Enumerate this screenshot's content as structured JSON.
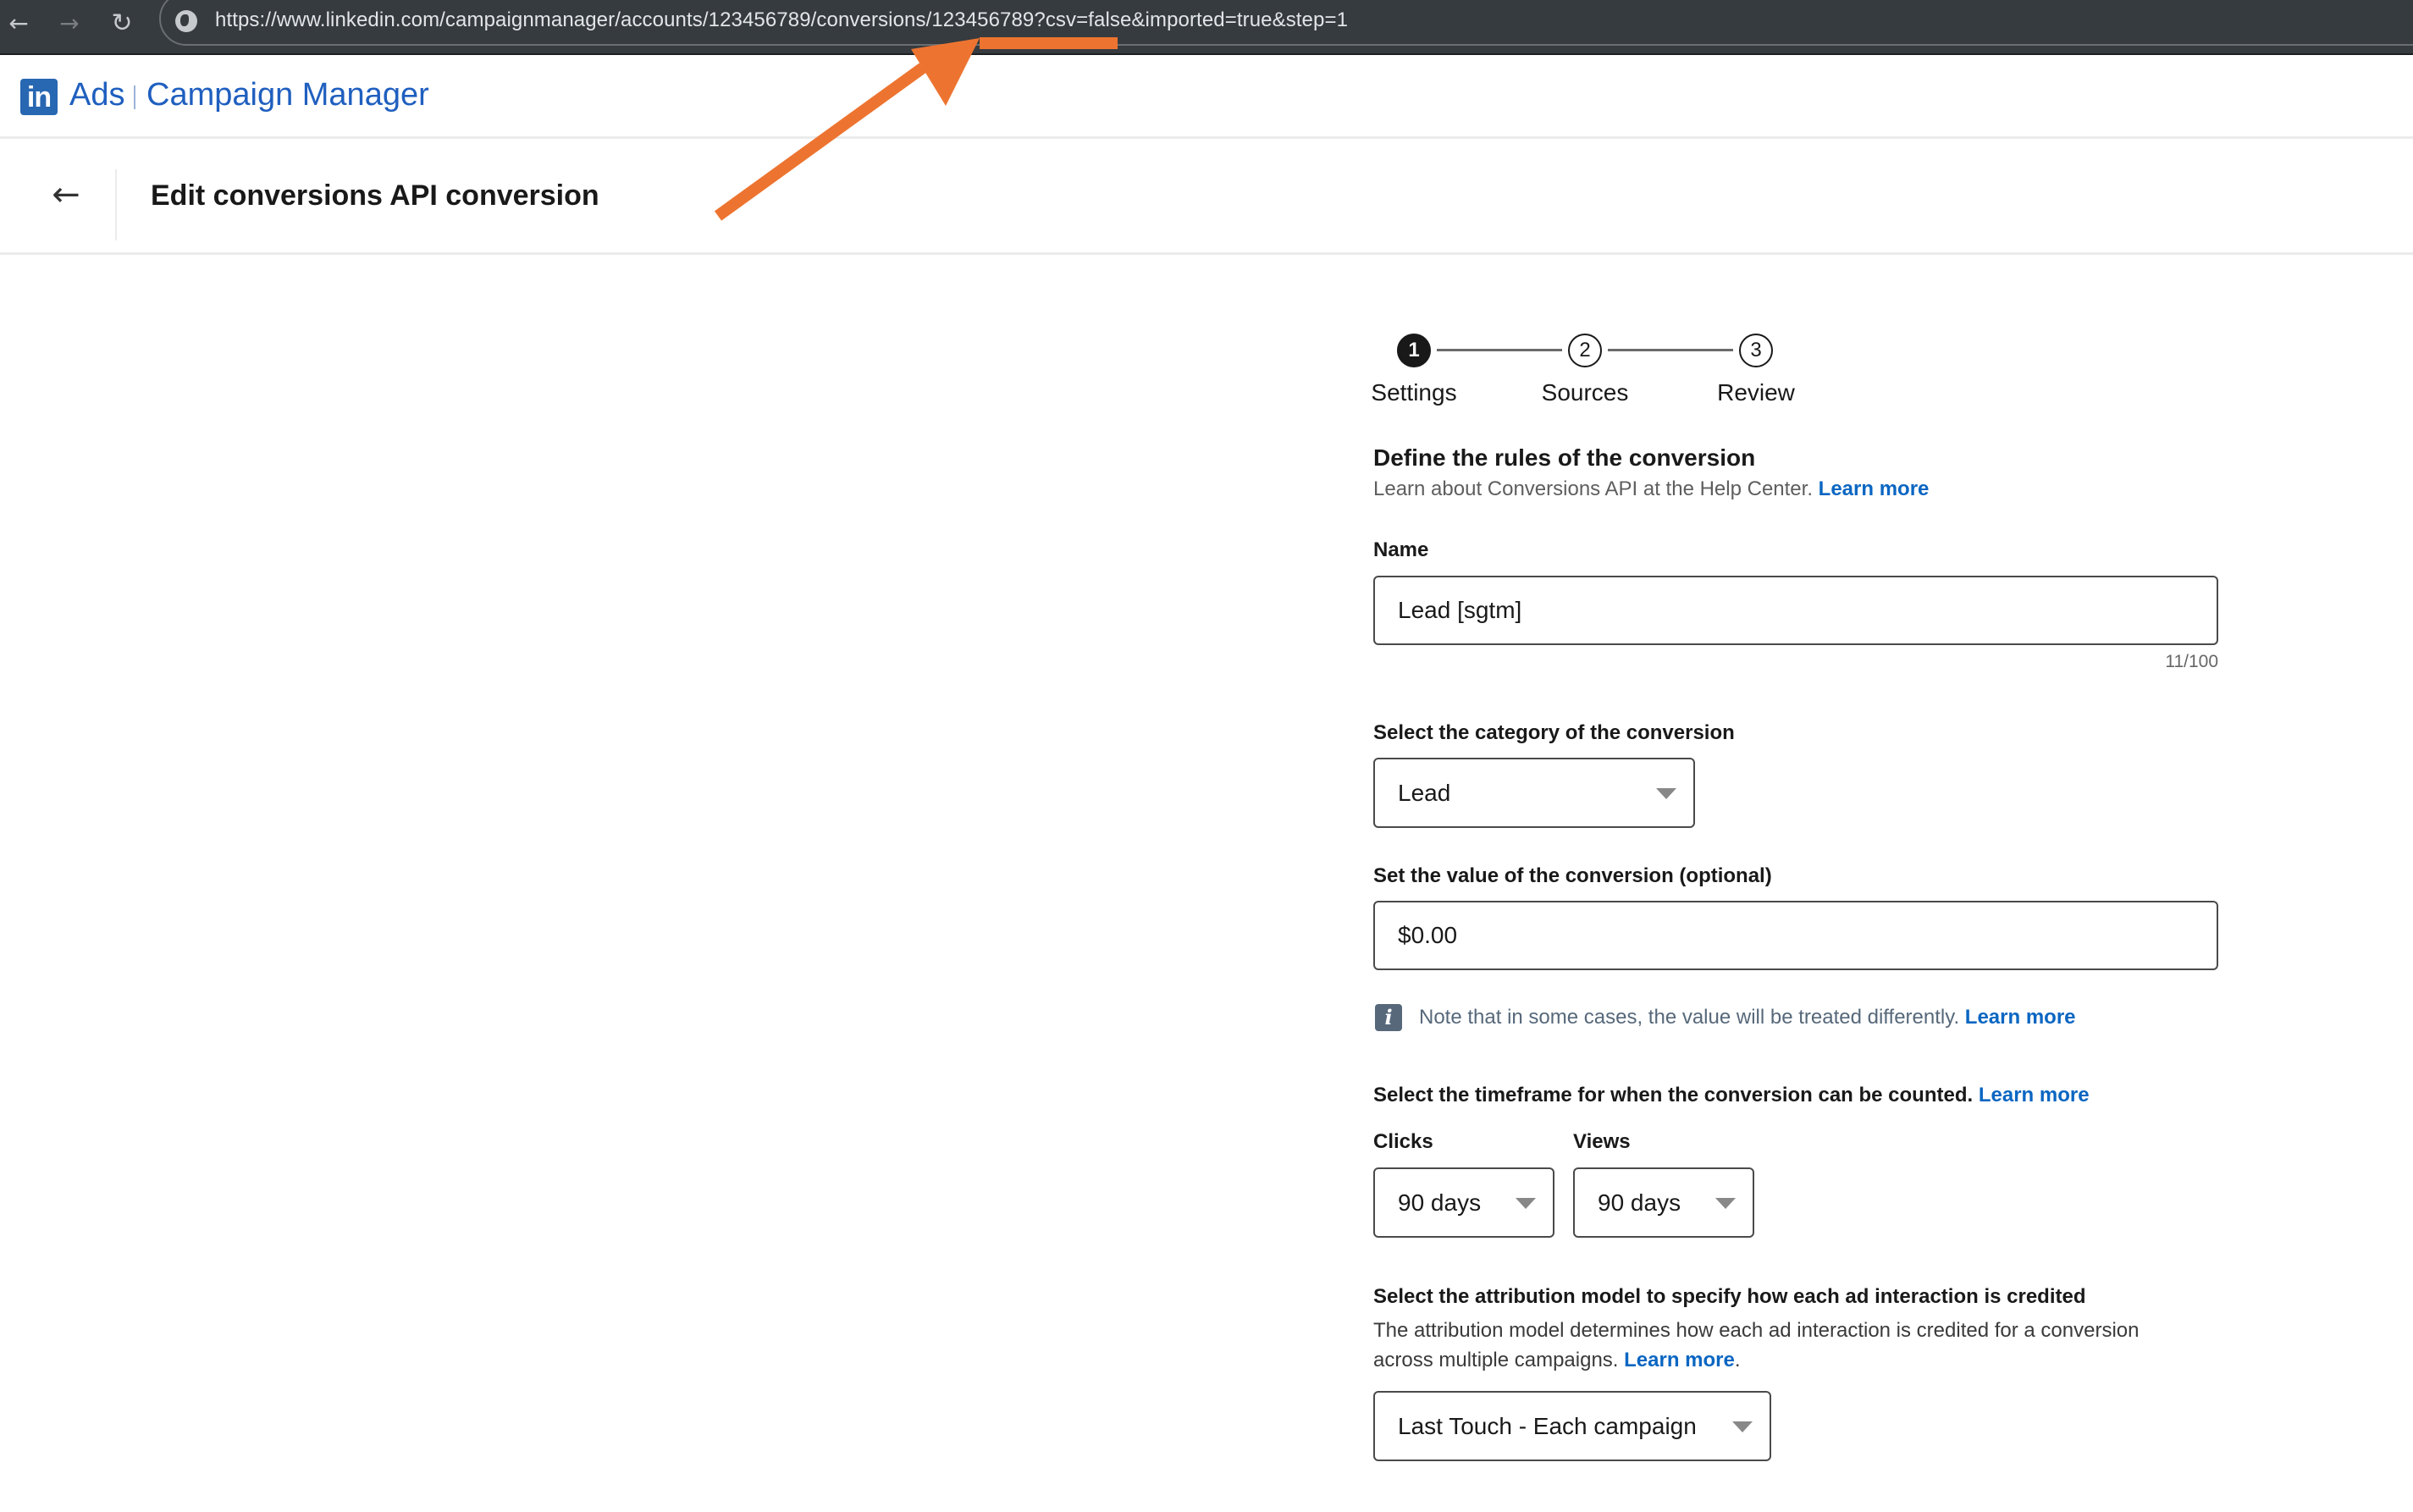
{
  "browser": {
    "back_icon": "arrow-left-icon",
    "forward_icon": "arrow-right-icon",
    "reload_icon": "reload-icon",
    "site_icon": "globe-icon",
    "url": "https://www.linkedin.com/campaignmanager/accounts/123456789/conversions/123456789?csv=false&imported=true&step=1"
  },
  "app_header": {
    "logo_text": "in",
    "product": "Ads",
    "app_name": "Campaign Manager"
  },
  "page_header": {
    "back_icon": "arrow-left-icon",
    "title": "Edit conversions API conversion"
  },
  "stepper": {
    "current_step": 1,
    "steps": [
      {
        "number": "1",
        "label": "Settings",
        "state": "active"
      },
      {
        "number": "2",
        "label": "Sources",
        "state": "upcoming"
      },
      {
        "number": "3",
        "label": "Review",
        "state": "upcoming"
      }
    ]
  },
  "form": {
    "section_title": "Define the rules of the conversion",
    "section_subtitle": "Learn about Conversions API at the Help Center.",
    "section_link": "Learn more",
    "name": {
      "label": "Name",
      "value": "Lead [sgtm]",
      "counter": "11/100"
    },
    "category": {
      "label": "Select the category of the conversion",
      "selected": "Lead"
    },
    "value": {
      "label": "Set the value of the conversion (optional)",
      "value": "$0.00",
      "note": "Note that in some cases, the value will be treated differently.",
      "note_link": "Learn more",
      "note_icon": "info-icon"
    },
    "timeframe": {
      "label": "Select the timeframe for when the conversion can be counted.",
      "link": "Learn more",
      "clicks_label": "Clicks",
      "clicks_selected": "90 days",
      "views_label": "Views",
      "views_selected": "90 days"
    },
    "attribution": {
      "label": "Select the attribution model to specify how each ad interaction is credited",
      "description_line1": "The attribution model determines how each ad interaction is credited for a conversion",
      "description_line2": "across multiple campaigns.",
      "link": "Learn more",
      "link_suffix": ".",
      "selected": "Last Touch - Each campaign"
    }
  },
  "annotation": {
    "type": "arrow-with-underline",
    "target": "conversion ID in URL",
    "color": "#ed7430"
  }
}
